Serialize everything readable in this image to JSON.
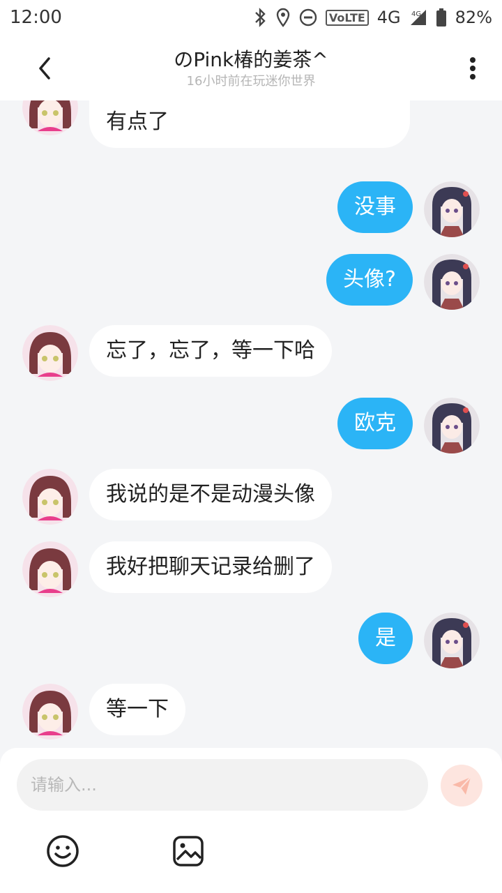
{
  "status_bar": {
    "time": "12:00",
    "network": "VoLTE",
    "signal": "4G",
    "signal_small": "4G",
    "battery": "82%",
    "icons": [
      "bluetooth-icon",
      "location-icon",
      "do-not-disturb-icon",
      "volte-icon",
      "signal-icon",
      "battery-icon"
    ]
  },
  "header": {
    "title": "のPink椿的姜茶^",
    "subtitle": "16小时前在玩迷你世界",
    "back_icon": "chevron-left-icon",
    "more_icon": "more-vertical-icon"
  },
  "messages": [
    {
      "side": "in",
      "text": "你的帖子太多了，所以我就没有点了"
    },
    {
      "side": "out",
      "text": "没事"
    },
    {
      "side": "out",
      "text": "头像?"
    },
    {
      "side": "in",
      "text": "忘了，忘了，等一下哈"
    },
    {
      "side": "out",
      "text": "欧克"
    },
    {
      "side": "in",
      "text": "我说的是不是动漫头像"
    },
    {
      "side": "in",
      "text": "我好把聊天记录给删了"
    },
    {
      "side": "out",
      "text": "是"
    },
    {
      "side": "in",
      "text": "等一下"
    }
  ],
  "input": {
    "placeholder": "请输入...",
    "value": ""
  },
  "toolbar": {
    "send_icon": "send-icon",
    "emoji_icon": "emoji-icon",
    "image_icon": "image-icon"
  },
  "colors": {
    "outgoing_bubble": "#2bb4f6",
    "incoming_bubble": "#ffffff",
    "chat_background": "#f4f5f7",
    "send_button": "#fde5df"
  }
}
